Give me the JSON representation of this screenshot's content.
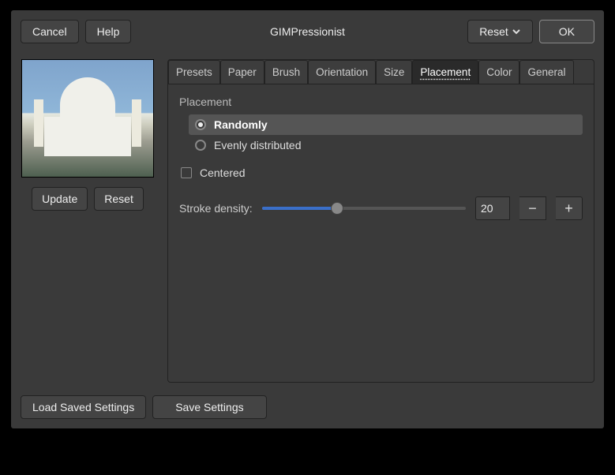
{
  "header": {
    "cancel": "Cancel",
    "help": "Help",
    "title": "GIMPressionist",
    "reset": "Reset",
    "ok": "OK"
  },
  "preview": {
    "update": "Update",
    "reset": "Reset"
  },
  "tabs": {
    "presets": "Presets",
    "paper": "Paper",
    "brush": "Brush",
    "orientation": "Orientation",
    "size": "Size",
    "placement": "Placement",
    "color": "Color",
    "general": "General"
  },
  "panel": {
    "section": "Placement",
    "randomly": "Randomly",
    "evenly": "Evenly distributed",
    "centered": "Centered",
    "stroke_density_label": "Stroke density:",
    "stroke_density_value": "20",
    "slider_percent": 37
  },
  "footer": {
    "load": "Load Saved Settings",
    "save": "Save Settings"
  }
}
